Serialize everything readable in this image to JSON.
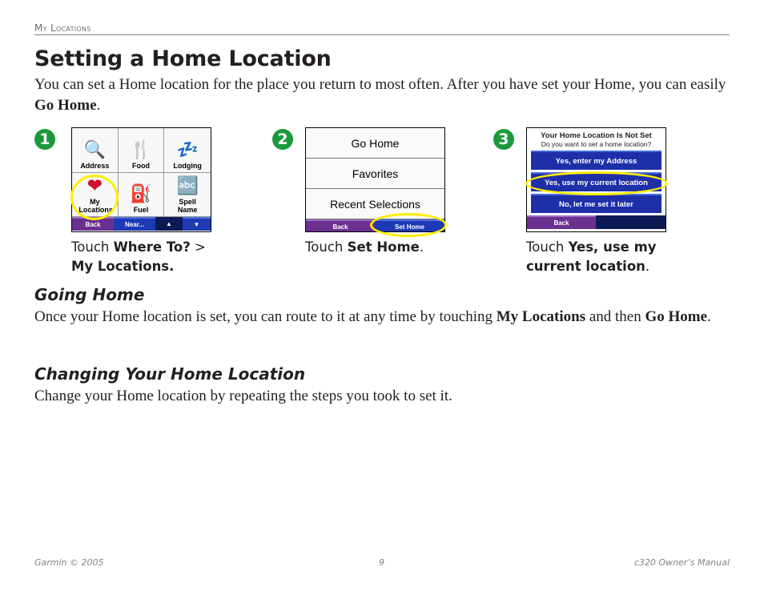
{
  "header": {
    "section": "My Locations"
  },
  "title": "Setting a Home Location",
  "intro": {
    "text": "You can set a Home location for the place you return to most often. After you have set your Home, you can easily ",
    "bold": "Go Home",
    "end": "."
  },
  "steps": [
    {
      "number": "1",
      "screen": {
        "cells": [
          {
            "label": "Address",
            "icon": "address-icon",
            "glyph": "🔍"
          },
          {
            "label": "Food",
            "icon": "food-icon",
            "glyph": "🍴"
          },
          {
            "label": "Lodging",
            "icon": "lodging-icon",
            "glyph": "💤"
          },
          {
            "label": "My Locations",
            "icon": "heart-icon",
            "glyph": "❤"
          },
          {
            "label": "Fuel",
            "icon": "fuel-icon",
            "glyph": "⛽"
          },
          {
            "label": "Spell Name",
            "icon": "spell-name-icon",
            "glyph": "🔤"
          }
        ],
        "buttons": {
          "back": "Back",
          "near": "Near...",
          "up": "▲",
          "down": "▼"
        }
      },
      "caption": {
        "pre": "Touch ",
        "bold1": "Where To?",
        "mid": " > ",
        "bold2": "My Locations."
      }
    },
    {
      "number": "2",
      "screen": {
        "items": [
          "Go Home",
          "Favorites",
          "Recent Selections"
        ],
        "buttons": {
          "back": "Back",
          "set_home": "Set Home"
        }
      },
      "caption": {
        "pre": "Touch ",
        "bold": "Set Home",
        "end": "."
      }
    },
    {
      "number": "3",
      "screen": {
        "title": "Your Home Location Is Not Set",
        "subtitle": "Do you want to set a home location?",
        "options": [
          "Yes, enter my Address",
          "Yes, use my current location",
          "No, let me set it later"
        ],
        "buttons": {
          "back": "Back"
        }
      },
      "caption": {
        "pre": "Touch ",
        "bold": "Yes, use my current location",
        "end": "."
      }
    }
  ],
  "going_home": {
    "heading": "Going Home",
    "text1": "Once your Home location is set, you can route to it at any time by touching ",
    "bold1": "My Locations",
    "text2": " and then ",
    "bold2": "Go Home",
    "end": "."
  },
  "changing": {
    "heading": "Changing Your Home Location",
    "text": "Change your Home location by repeating the steps you took to set it."
  },
  "footer": {
    "left": "Garmin © 2005",
    "center": "9",
    "right": "c320 Owner’s Manual"
  },
  "colors": {
    "step_badge": "#1a9a3c",
    "highlight": "#ffee00",
    "back_button": "#6b2f8f",
    "blue_button": "#1d3ab5"
  }
}
